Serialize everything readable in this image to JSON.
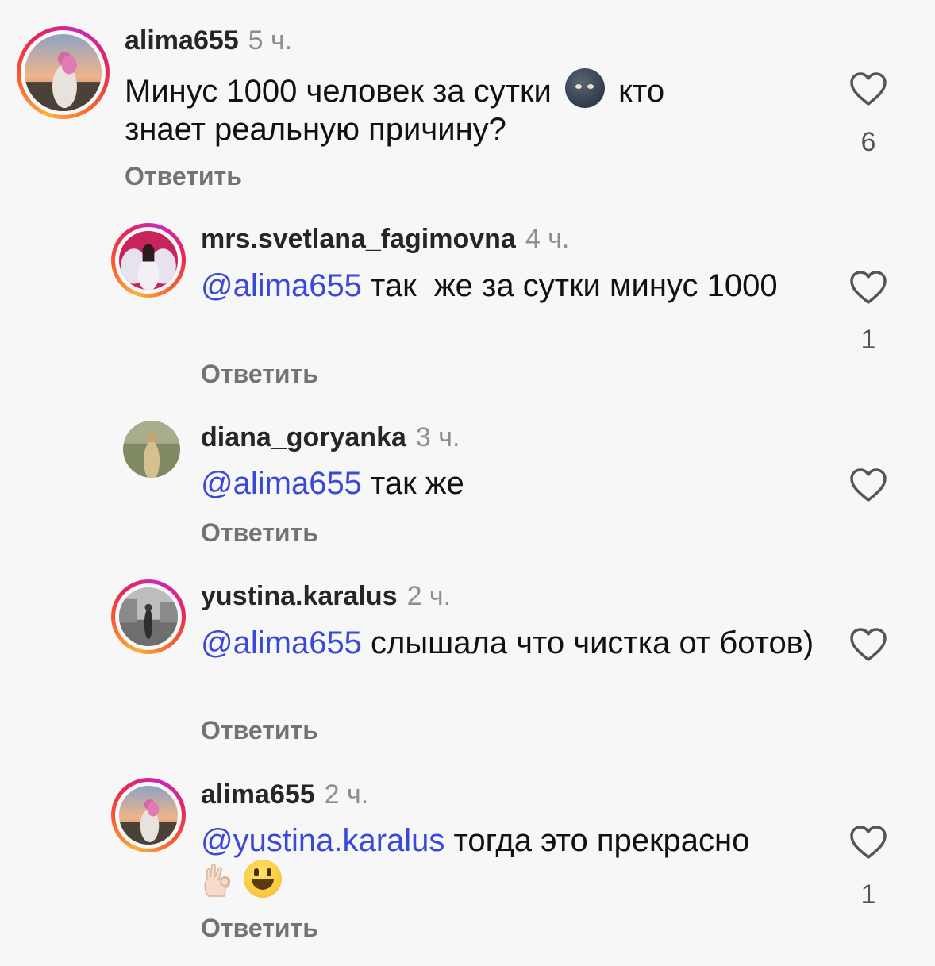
{
  "comments": [
    {
      "username": "alima655",
      "time": "5 ч.",
      "text": "Минус 1000 человек за сутки",
      "text_after": "кто знает реальную причину?",
      "emoji": "new-moon-face",
      "reply_label": "Ответить",
      "likes": "6"
    },
    {
      "username": "mrs.svetlana_fagimovna",
      "time": "4 ч.",
      "mention": "@alima655",
      "text": " так  же за сутки минус 1000",
      "reply_label": "Ответить",
      "likes": "1"
    },
    {
      "username": "diana_goryanka",
      "time": "3 ч.",
      "mention": "@alima655",
      "text": " так же",
      "reply_label": "Ответить",
      "likes": ""
    },
    {
      "username": "yustina.karalus",
      "time": "2 ч.",
      "mention": "@alima655",
      "text": " слышала что чистка от ботов)",
      "reply_label": "Ответить",
      "likes": ""
    },
    {
      "username": "alima655",
      "time": "2 ч.",
      "mention": "@yustina.karalus",
      "text": " тогда это прекрасно",
      "emojis": [
        "ok-hand",
        "grinning-face"
      ],
      "reply_label": "Ответить",
      "likes": "1"
    }
  ],
  "icons": {
    "like": "heart-outline-icon"
  },
  "colors": {
    "background": "#f7f7f7",
    "mention": "#3b4ad6",
    "muted": "#8e8e8e",
    "story_ring": "#e4245b"
  }
}
